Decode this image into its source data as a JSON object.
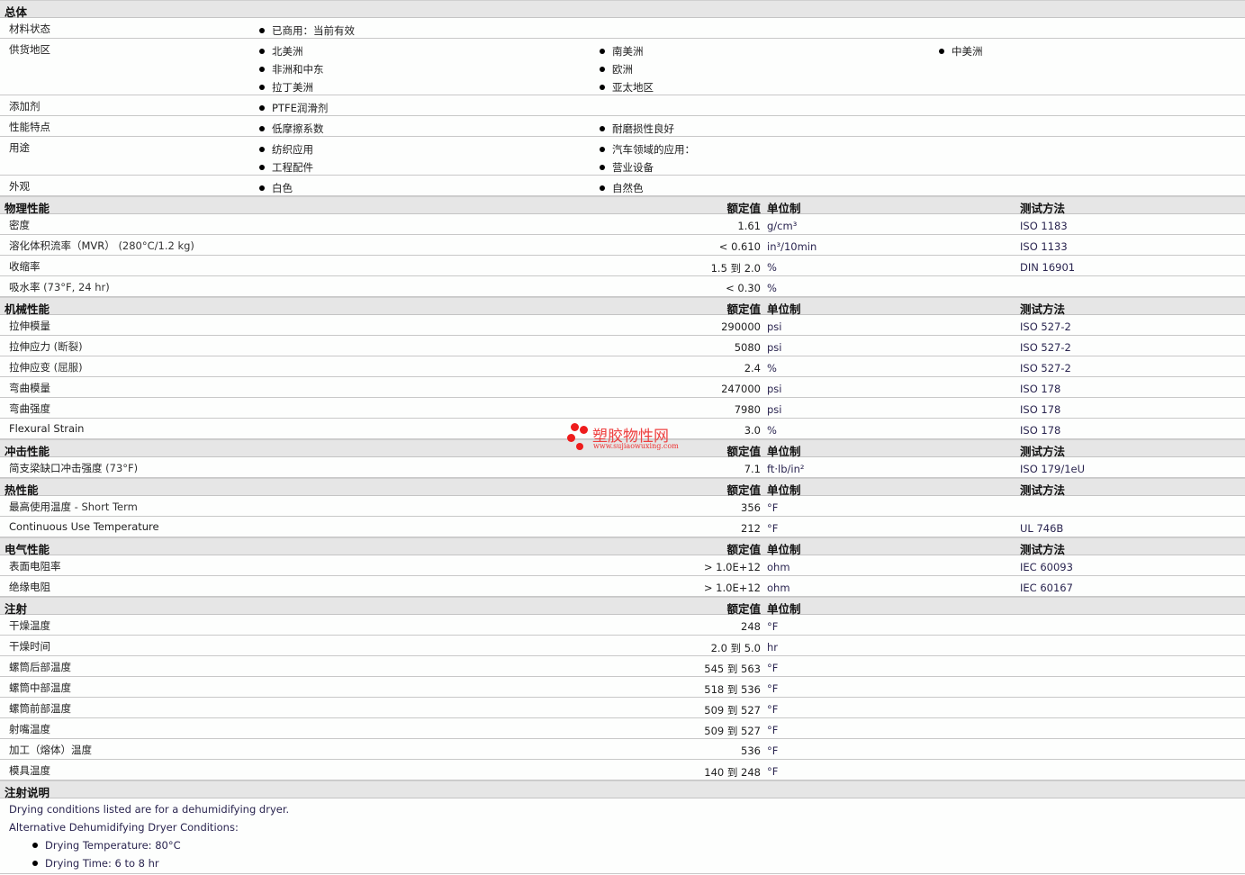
{
  "general": {
    "title": "总体",
    "rows": [
      {
        "label": "材料状态",
        "cols": [
          [
            "已商用：当前有效"
          ]
        ]
      },
      {
        "label": "供货地区",
        "cols": [
          [
            "北美洲",
            "非洲和中东",
            "拉丁美洲"
          ],
          [
            "南美洲",
            "欧洲",
            "亚太地区"
          ],
          [
            "中美洲"
          ]
        ]
      },
      {
        "label": "添加剂",
        "cols": [
          [
            "PTFE润滑剂"
          ]
        ]
      },
      {
        "label": "性能特点",
        "cols": [
          [
            "低摩擦系数"
          ],
          [
            "耐磨损性良好"
          ]
        ]
      },
      {
        "label": "用途",
        "cols": [
          [
            "纺织应用",
            "工程配件"
          ],
          [
            "汽车领域的应用：",
            "营业设备"
          ]
        ]
      },
      {
        "label": "外观",
        "cols": [
          [
            "白色"
          ],
          [
            "自然色"
          ]
        ]
      }
    ]
  },
  "headers": {
    "value": "额定值",
    "unit": "单位制",
    "method": "测试方法"
  },
  "sections": [
    {
      "title": "物理性能",
      "method": true,
      "rows": [
        {
          "label": "密度",
          "sub": "",
          "value": "1.61",
          "unit": "g/cm³",
          "method": "ISO 1183"
        },
        {
          "label": "溶化体积流率（MVR）",
          "sub": "(280°C/1.2 kg)",
          "value": "< 0.610",
          "unit": "in³/10min",
          "method": "ISO 1133"
        },
        {
          "label": "收缩率",
          "sub": "",
          "value": "1.5 到  2.0",
          "unit": "%",
          "method": "DIN 16901"
        },
        {
          "label": "吸水率",
          "sub": "(73°F, 24 hr)",
          "value": "< 0.30",
          "unit": "%",
          "method": ""
        }
      ]
    },
    {
      "title": "机械性能",
      "method": true,
      "rows": [
        {
          "label": "拉伸模量",
          "sub": "",
          "value": "290000",
          "unit": "psi",
          "method": "ISO 527-2"
        },
        {
          "label": "拉伸应力",
          "sub": "(断裂)",
          "value": "5080",
          "unit": "psi",
          "method": "ISO 527-2"
        },
        {
          "label": "拉伸应变",
          "sub": "(屈服)",
          "value": "2.4",
          "unit": "%",
          "method": "ISO 527-2"
        },
        {
          "label": "弯曲模量",
          "sub": "",
          "value": "247000",
          "unit": "psi",
          "method": "ISO 178"
        },
        {
          "label": "弯曲强度",
          "sub": "",
          "value": "7980",
          "unit": "psi",
          "method": "ISO 178"
        },
        {
          "label": "Flexural Strain",
          "sub": "",
          "value": "3.0",
          "unit": "%",
          "method": "ISO 178"
        }
      ]
    },
    {
      "title": "冲击性能",
      "method": true,
      "rows": [
        {
          "label": "简支梁缺口冲击强度",
          "sub": "(73°F)",
          "value": "7.1",
          "unit": "ft·lb/in²",
          "method": "ISO 179/1eU"
        }
      ]
    },
    {
      "title": "热性能",
      "method": true,
      "rows": [
        {
          "label": "最高使用温度",
          "sub": "- Short Term",
          "value": "356",
          "unit": "°F",
          "method": ""
        },
        {
          "label": "Continuous Use Temperature",
          "sub": "",
          "value": "212",
          "unit": "°F",
          "method": "UL 746B"
        }
      ]
    },
    {
      "title": "电气性能",
      "method": true,
      "rows": [
        {
          "label": "表面电阻率",
          "sub": "",
          "value": "> 1.0E+12",
          "unit": "ohm",
          "method": "IEC 60093"
        },
        {
          "label": "绝缘电阻",
          "sub": "",
          "value": "> 1.0E+12",
          "unit": "ohm",
          "method": "IEC 60167"
        }
      ]
    },
    {
      "title": "注射",
      "method": false,
      "rows": [
        {
          "label": "干燥温度",
          "sub": "",
          "value": "248",
          "unit": "°F",
          "method": ""
        },
        {
          "label": "干燥时间",
          "sub": "",
          "value": "2.0 到  5.0",
          "unit": "hr",
          "method": ""
        },
        {
          "label": "螺筒后部温度",
          "sub": "",
          "value": "545 到  563",
          "unit": "°F",
          "method": ""
        },
        {
          "label": "螺筒中部温度",
          "sub": "",
          "value": "518 到  536",
          "unit": "°F",
          "method": ""
        },
        {
          "label": "螺筒前部温度",
          "sub": "",
          "value": "509 到  527",
          "unit": "°F",
          "method": ""
        },
        {
          "label": "射嘴温度",
          "sub": "",
          "value": "509 到  527",
          "unit": "°F",
          "method": ""
        },
        {
          "label": "加工（熔体）温度",
          "sub": "",
          "value": "536",
          "unit": "°F",
          "method": ""
        },
        {
          "label": "模具温度",
          "sub": "",
          "value": "140 到  248",
          "unit": "°F",
          "method": ""
        }
      ]
    }
  ],
  "notes": {
    "title": "注射说明",
    "lines": [
      "Drying conditions listed are for a dehumidifying dryer.",
      "Alternative Dehumidifying Dryer Conditions:"
    ],
    "bullets": [
      "Drying Temperature: 80°C",
      "Drying Time: 6 to 8 hr"
    ]
  },
  "watermark": {
    "text": "塑胶物性网",
    "url": "www.sujiaowuxing.com"
  }
}
